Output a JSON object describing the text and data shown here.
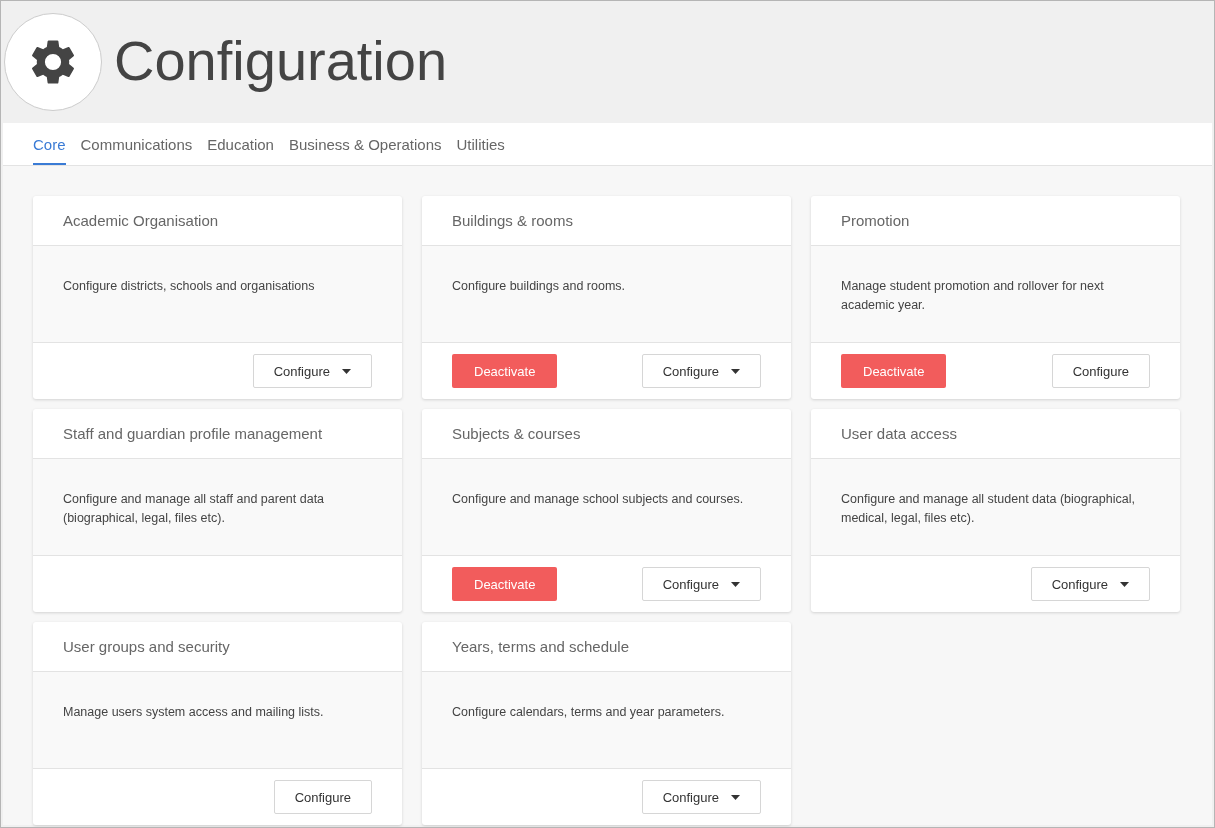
{
  "header": {
    "title": "Configuration"
  },
  "tabs": [
    {
      "label": "Core",
      "selected": true
    },
    {
      "label": "Communications",
      "selected": false
    },
    {
      "label": "Education",
      "selected": false
    },
    {
      "label": "Business & Operations",
      "selected": false
    },
    {
      "label": "Utilities",
      "selected": false
    }
  ],
  "cards": [
    {
      "title": "Academic Organisation",
      "description": "Configure districts, schools and organisations",
      "buttons": [
        {
          "kind": "dropdown",
          "label": "Configure"
        }
      ]
    },
    {
      "title": "Buildings & rooms",
      "description": "Configure buildings and rooms.",
      "buttons": [
        {
          "kind": "danger",
          "label": "Deactivate"
        },
        {
          "kind": "dropdown",
          "label": "Configure"
        }
      ]
    },
    {
      "title": "Promotion",
      "description": "Manage student promotion and rollover for next academic year.",
      "buttons": [
        {
          "kind": "danger",
          "label": "Deactivate"
        },
        {
          "kind": "plain",
          "label": "Configure"
        }
      ]
    },
    {
      "title": "Staff and guardian profile management",
      "description": "Configure and manage all staff and parent data (biographical, legal, files etc)."
    },
    {
      "title": "Subjects & courses",
      "description": "Configure and manage school subjects and courses.",
      "buttons": [
        {
          "kind": "danger",
          "label": "Deactivate"
        },
        {
          "kind": "dropdown",
          "label": "Configure"
        }
      ]
    },
    {
      "title": "User data access",
      "description": "Configure and manage all student data (biographical, medical, legal, files etc).",
      "buttons": [
        {
          "kind": "dropdown",
          "label": "Configure"
        }
      ]
    },
    {
      "title": "User groups and security",
      "description": "Manage users system access and mailing lists.",
      "buttons": [
        {
          "kind": "plain",
          "label": "Configure"
        }
      ]
    },
    {
      "title": "Years, terms and schedule",
      "description": "Configure calendars, terms and year parameters.",
      "buttons": [
        {
          "kind": "dropdown",
          "label": "Configure"
        }
      ]
    }
  ]
}
